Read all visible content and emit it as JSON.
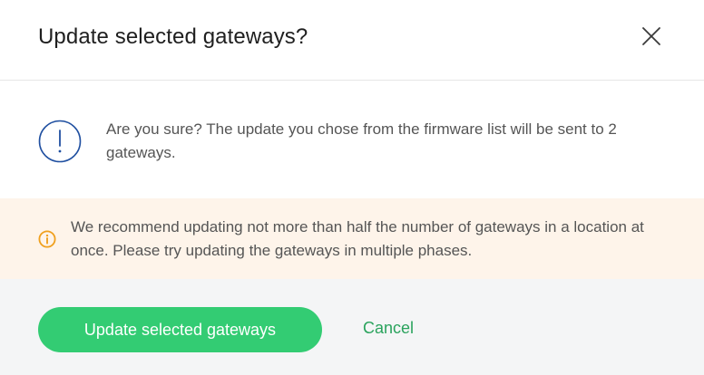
{
  "dialog": {
    "title": "Update selected gateways?",
    "close_icon": "close-icon"
  },
  "confirm": {
    "icon": "exclamation-circle-icon",
    "message": "Are you sure? The update you chose from the firmware list will be sent to 2 gateways."
  },
  "warning": {
    "icon": "info-circle-icon",
    "text": "We recommend updating not more than half the number of gateways in a location at once. Please try updating the gateways in multiple phases."
  },
  "footer": {
    "primary_label": "Update selected gateways",
    "cancel_label": "Cancel"
  },
  "colors": {
    "primary": "#33cc73",
    "link": "#2aa35d",
    "info_icon": "#1f4fa0",
    "warning_icon": "#f0a01e",
    "warning_bg": "#fef4ea",
    "footer_bg": "#f4f5f6"
  }
}
